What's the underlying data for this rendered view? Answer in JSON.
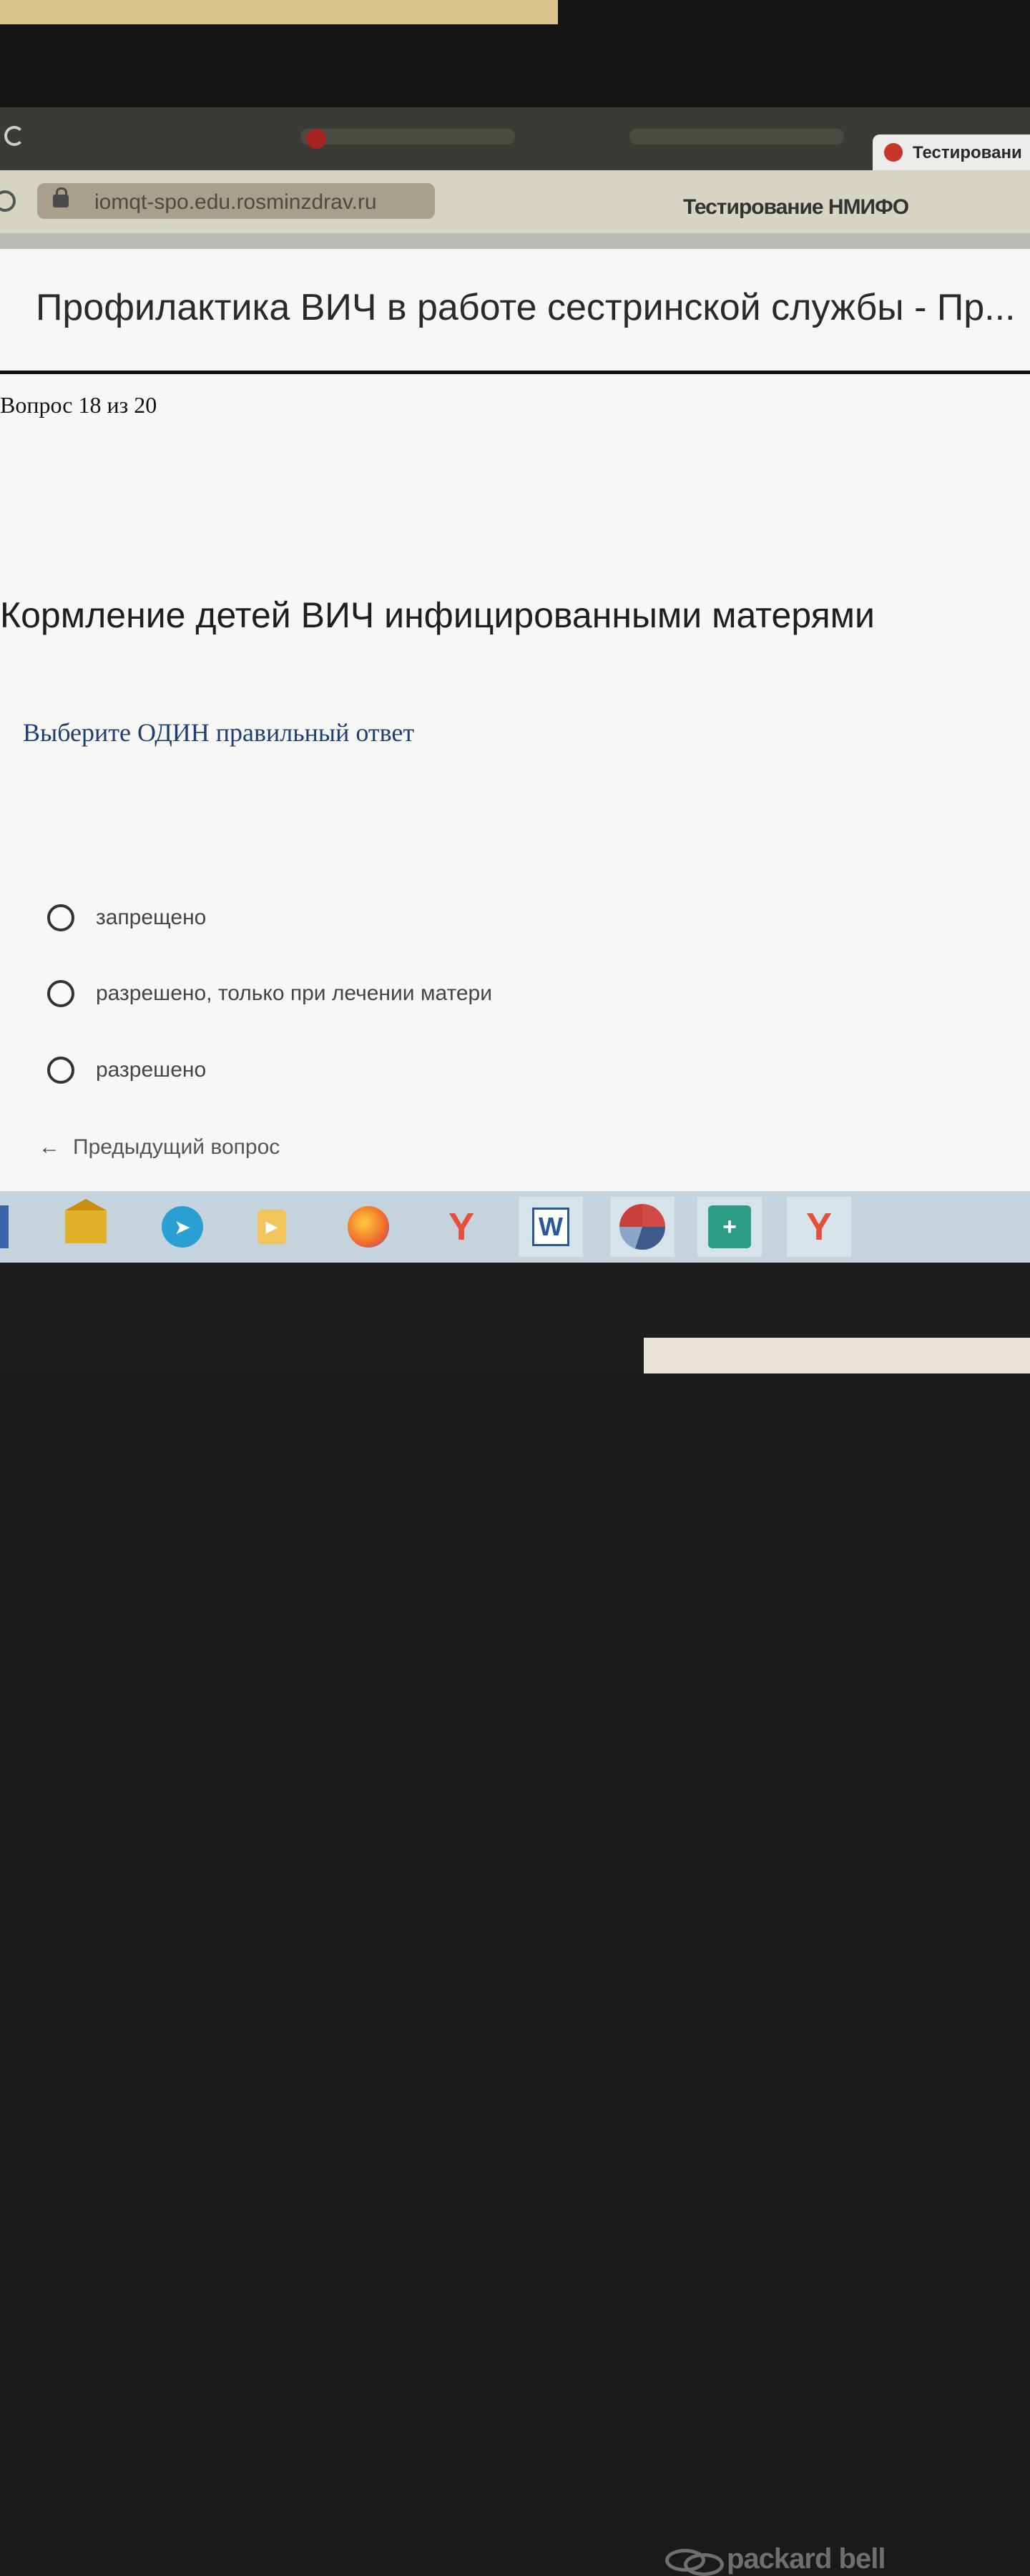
{
  "browser": {
    "active_tab_label": "Тестировани",
    "url": "iomqt-spo.edu.rosminzdrav.ru",
    "page_header": "Тестирование НМИФО"
  },
  "page": {
    "course_title": "Профилактика ВИЧ в работе сестринской службы - Пр...",
    "question_counter": "Вопрос 18 из 20",
    "question_text": "Кормление детей ВИЧ инфицированными матерями",
    "instruction": "Выберите ОДИН правильный ответ",
    "options": [
      {
        "label": "запрещено"
      },
      {
        "label": "разрешено, только при лечении матери"
      },
      {
        "label": "разрешено"
      }
    ],
    "prev_button": {
      "arrow": "←",
      "label": "Предыдущий вопрос"
    }
  },
  "taskbar": {
    "items": [
      "mail-app",
      "telegram",
      "media-player",
      "firefox",
      "yandex-browser",
      "word",
      "app-ball",
      "medical-app",
      "yandex-browser"
    ],
    "telegram_glyph": "➤",
    "media_glyph": "▶",
    "word_glyph": "W",
    "yandex_glyph": "Y",
    "medical_glyph": "+"
  },
  "device": {
    "brand": "packard bell"
  }
}
